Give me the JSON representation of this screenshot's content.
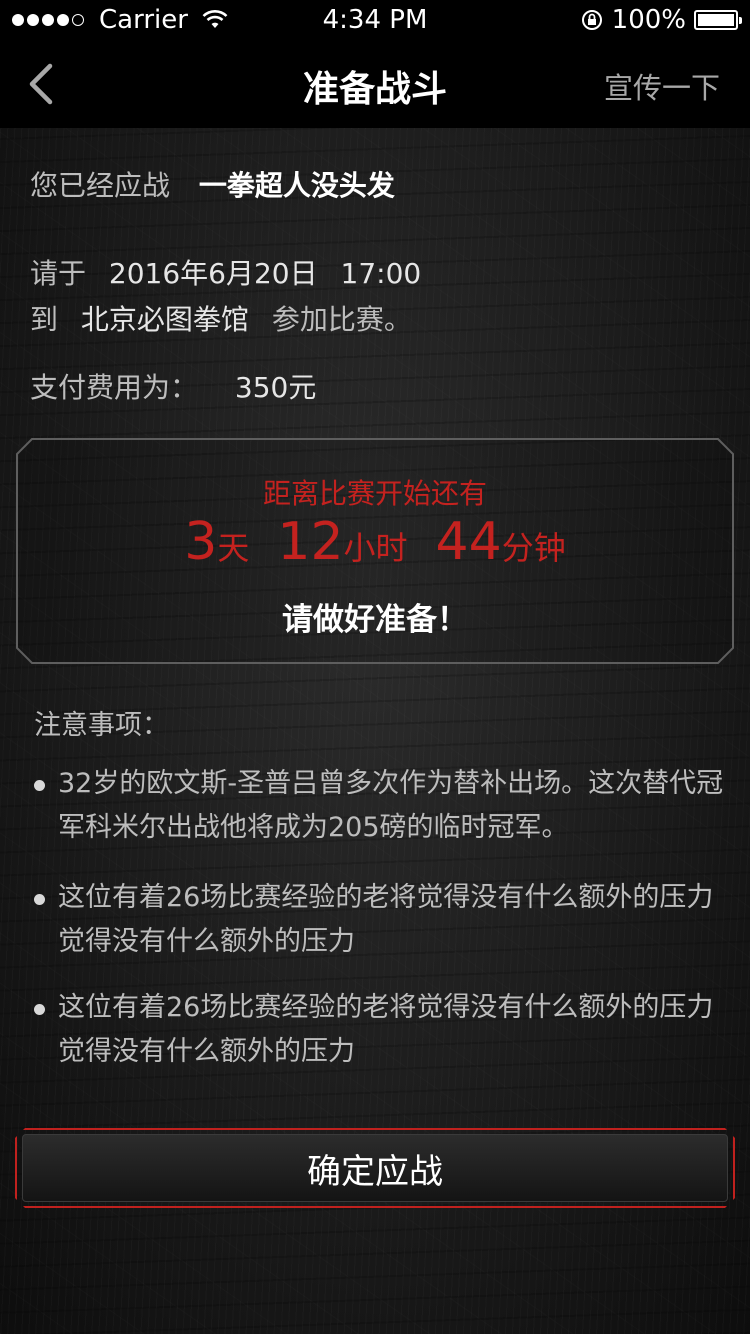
{
  "status_bar": {
    "carrier": "Carrier",
    "time": "4:34 PM",
    "battery": "100%"
  },
  "nav": {
    "title": "准备战斗",
    "share_label": "宣传一下",
    "back_icon": "chevron-left-icon"
  },
  "challenge": {
    "accepted_prefix": "您已经应战",
    "opponent_name": "一拳超人没头发",
    "please_prefix": "请于",
    "date": "2016年6月20日",
    "time": "17:00",
    "to_prefix": "到",
    "venue": "北京必图拳馆",
    "join_suffix": "参加比赛。",
    "fee_label": "支付费用为：",
    "fee_value": "350元"
  },
  "countdown": {
    "label": "距离比赛开始还有",
    "days": "3",
    "days_unit": "天",
    "hours": "12",
    "hours_unit": "小时",
    "minutes": "44",
    "minutes_unit": "分钟",
    "ready_text": "请做好准备！"
  },
  "notes": {
    "title": "注意事项：",
    "items": [
      "32岁的欧文斯-圣普吕曾多次作为替补出场。这次替代冠军科米尔出战他将成为205磅的临时冠军。",
      "这位有着26场比赛经验的老将觉得没有什么额外的压力觉得没有什么额外的压力",
      "这位有着26场比赛经验的老将觉得没有什么额外的压力觉得没有什么额外的压力"
    ]
  },
  "confirm_button": "确定应战",
  "colors": {
    "accent_red": "#c4221f",
    "nav_bg": "#000000",
    "text_muted": "#bdbdbd"
  }
}
